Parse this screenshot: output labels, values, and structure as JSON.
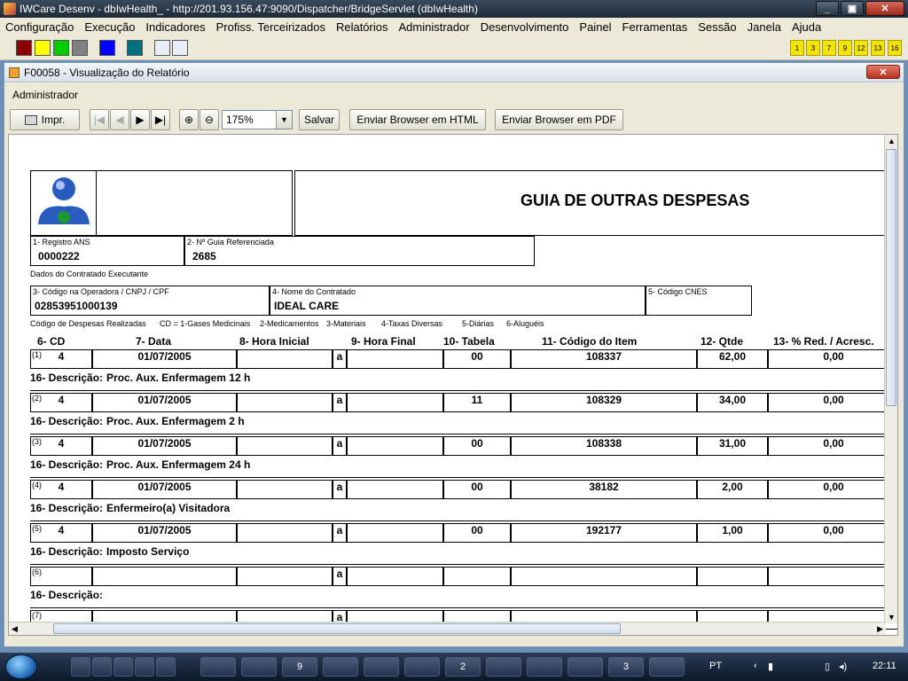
{
  "window": {
    "title": "IWCare Desenv - dbIwHealth_ - http://201.93.156.47:9090/Dispatcher/BridgeServlet (dbIwHealth)"
  },
  "menu": [
    "Configuração",
    "Execução",
    "Indicadores",
    "Profiss. Terceirizados",
    "Relatórios",
    "Administrador",
    "Desenvolvimento",
    "Painel",
    "Ferramentas",
    "Sessão",
    "Janela",
    "Ajuda"
  ],
  "color_swatches": [
    "#8b0000",
    "#ffff00",
    "#00cc00",
    "#808080",
    "#0000ff",
    "#007080"
  ],
  "quick_buttons": [
    "1",
    "3",
    "7",
    "9",
    "12",
    "13",
    "16"
  ],
  "frame": {
    "title": "F00058 - Visualização do Relatório",
    "user": "Administrador"
  },
  "toolbar": {
    "print": "Impr.",
    "zoom": "175%",
    "save": "Salvar",
    "send_html": "Enviar Browser em HTML",
    "send_pdf": "Enviar Browser em PDF"
  },
  "report": {
    "title": "GUIA DE OUTRAS DESPESAS",
    "registro_label": "1- Registro ANS",
    "registro_value": "0000222",
    "guia_label": "2- Nº Guia Referenciada",
    "guia_value": "2685",
    "contratado_section": "Dados do Contratado Executante",
    "codigo_label": "3- Código na Operadora / CNPJ / CPF",
    "codigo_value": "02853951000139",
    "nome_label": "4- Nome do Contratado",
    "nome_value": "IDEAL CARE",
    "cnes_label": "5- Código CNES",
    "legend": [
      "Código de Despesas Realizadas",
      "CD = 1-Gases Medicinais",
      "2-Medicamentos",
      "3-Materiais",
      "4-Taxas Diversas",
      "5-Diárias",
      "6-Aluguéis"
    ],
    "columns": {
      "cd": "6-  CD",
      "data": "7-  Data",
      "hora_ini": "8-  Hora Inicial",
      "hora_fim": "9-  Hora Final",
      "tabela": "10- Tabela",
      "item": "11-  Código do Item",
      "qtde": "12-  Qtde",
      "red": "13-  % Red. / Acresc."
    },
    "desc_prefix": "16- Descrição:",
    "separator": "a",
    "rows": [
      {
        "idx": "(1)",
        "cd": "4",
        "data": "01/07/2005",
        "tabela": "00",
        "item": "108337",
        "qtde": "62,00",
        "red": "0,00",
        "desc": "Proc. Aux. Enfermagem  12 h"
      },
      {
        "idx": "(2)",
        "cd": "4",
        "data": "01/07/2005",
        "tabela": "11",
        "item": "108329",
        "qtde": "34,00",
        "red": "0,00",
        "desc": "Proc. Aux. Enfermagem  2 h"
      },
      {
        "idx": "(3)",
        "cd": "4",
        "data": "01/07/2005",
        "tabela": "00",
        "item": "108338",
        "qtde": "31,00",
        "red": "0,00",
        "desc": "Proc. Aux. Enfermagem 24 h"
      },
      {
        "idx": "(4)",
        "cd": "4",
        "data": "01/07/2005",
        "tabela": "00",
        "item": "38182",
        "qtde": "2,00",
        "red": "0,00",
        "desc": "Enfermeiro(a) Visitadora"
      },
      {
        "idx": "(5)",
        "cd": "4",
        "data": "01/07/2005",
        "tabela": "00",
        "item": "192177",
        "qtde": "1,00",
        "red": "0,00",
        "desc": "Imposto Serviço"
      },
      {
        "idx": "(6)",
        "cd": "",
        "data": "",
        "tabela": "",
        "item": "",
        "qtde": "",
        "red": "",
        "desc": ""
      },
      {
        "idx": "(7)",
        "cd": "",
        "data": "",
        "tabela": "",
        "item": "",
        "qtde": "",
        "red": "",
        "desc": null
      }
    ]
  },
  "taskbar": {
    "language": "PT",
    "clock": "22:11",
    "tasks": [
      "9",
      "",
      "",
      "",
      "",
      "2",
      "",
      "",
      "",
      "3",
      ""
    ]
  }
}
